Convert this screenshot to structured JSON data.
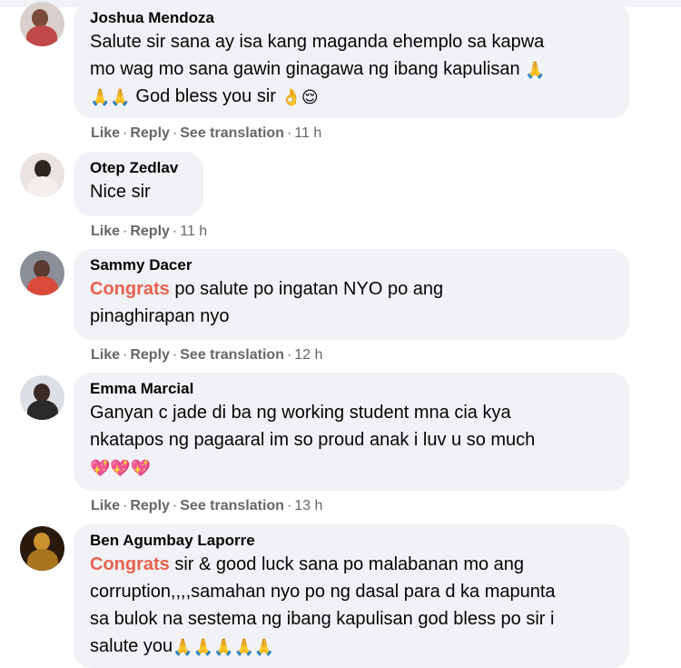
{
  "comments": [
    {
      "author": "Joshua Mendoza",
      "text_lines": [
        "Salute sir sana ay isa kang maganda ehemplo sa kapwa",
        "mo wag mo sana gawin ginagawa ng ibang kapulisan"
      ],
      "emoji_line_text": "God bless you sir",
      "emoji_glyphs": {
        "pray": "🙏",
        "ok": "👌",
        "relieved": "😌"
      },
      "actions": {
        "like": "Like",
        "reply": "Reply",
        "translate": "See translation",
        "time": "11 h"
      }
    },
    {
      "author": "Otep Zedlav",
      "text": "Nice sir",
      "actions": {
        "like": "Like",
        "reply": "Reply",
        "time": "11 h"
      }
    },
    {
      "author": "Sammy Dacer",
      "highlight": "Congrats",
      "text_line1_rest": " po salute po ingatan NYO po ang",
      "text_line2": "pinaghirapan nyo",
      "actions": {
        "like": "Like",
        "reply": "Reply",
        "translate": "See translation",
        "time": "12 h"
      }
    },
    {
      "author": "Emma Marcial",
      "text_lines": [
        "Ganyan c jade di ba ng working student mna cia kya",
        "nkatapos ng pagaaral im so proud anak i luv u so much"
      ],
      "emoji_glyphs": {
        "heart": "💖"
      },
      "actions": {
        "like": "Like",
        "reply": "Reply",
        "translate": "See translation",
        "time": "13 h"
      }
    },
    {
      "author": "Ben Agumbay Laporre",
      "highlight": "Congrats",
      "text_line1_rest": " sir & good luck sana po malabanan mo ang",
      "text_lines": [
        "corruption,,,,samahan nyo po ng dasal para d ka mapunta",
        "sa bulok na sestema ng ibang kapulisan god bless po sir i"
      ],
      "last_line_text": "salute you",
      "emoji_glyphs": {
        "pray": "🙏"
      }
    }
  ],
  "colors": {
    "bubble": "#f0f2f5",
    "highlight": "#e8614e",
    "meta": "#65676b"
  }
}
